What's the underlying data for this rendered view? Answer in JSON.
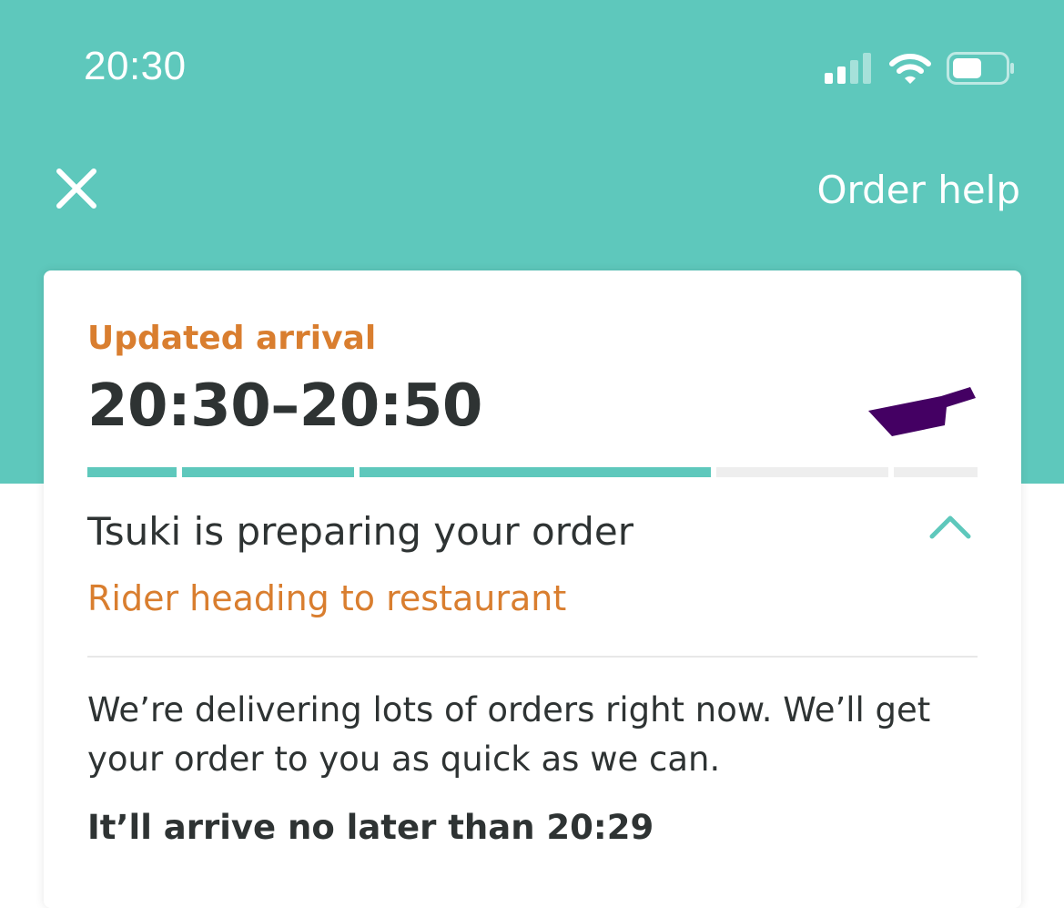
{
  "status_bar": {
    "time": "20:30",
    "signal_icon": "cellular-signal-icon",
    "wifi_icon": "wifi-icon",
    "battery_icon": "battery-icon",
    "battery_level": 0.55
  },
  "header": {
    "close_icon": "close-icon",
    "order_help_label": "Order help"
  },
  "card": {
    "updated_arrival_label": "Updated arrival",
    "arrival_window": "20:30–20:50",
    "rider_icon": "rider-icon",
    "progress": {
      "segments": 5,
      "completed_segments": 3
    },
    "preparing_status": "Tsuki is preparing your order",
    "expand_icon": "chevron-up-icon",
    "rider_status": "Rider heading to restaurant",
    "delay_message": "We’re delivering lots of orders right now. We’ll get your order to you as quick as we can.",
    "latest_arrival": "It’ll arrive no later than 20:29"
  },
  "colors": {
    "brand_teal": "#5ec8bc",
    "accent_orange": "#d97e2f",
    "text_dark": "#2e3333",
    "rider_purple": "#440063"
  }
}
